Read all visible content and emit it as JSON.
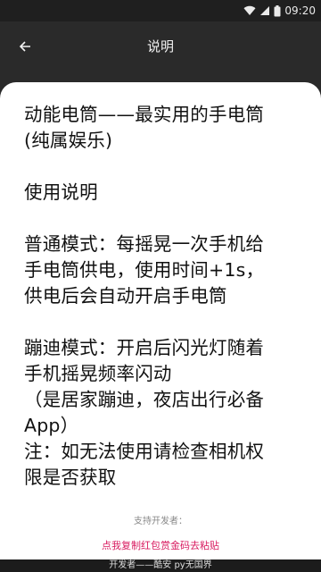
{
  "status_bar": {
    "time": "09:20",
    "icons": [
      "wifi-icon",
      "cellular-signal-icon",
      "battery-icon"
    ]
  },
  "app_bar": {
    "title": "说明",
    "back_icon": "arrow-left-icon"
  },
  "content": {
    "text": "动能电筒——最实用的手电筒\n(纯属娱乐)\n\n使用说明\n\n普通模式：每摇晃一次手机给\n手电筒供电，使用时间+1s，\n供电后会自动开启手电筒\n\n蹦迪模式：开启后闪光灯随着\n手机摇晃频率闪动\n（是居家蹦迪，夜店出行必备\nApp）\n注：如无法使用请检查相机权\n限是否获取"
  },
  "support": {
    "label": "支持开发者：",
    "link": "点我复制红包赏金码去粘贴"
  },
  "footer": {
    "text": "开发者——酷安 py无国界"
  },
  "colors": {
    "background": "#2a2a2a",
    "sheet": "#ffffff",
    "link": "#d81b60"
  }
}
